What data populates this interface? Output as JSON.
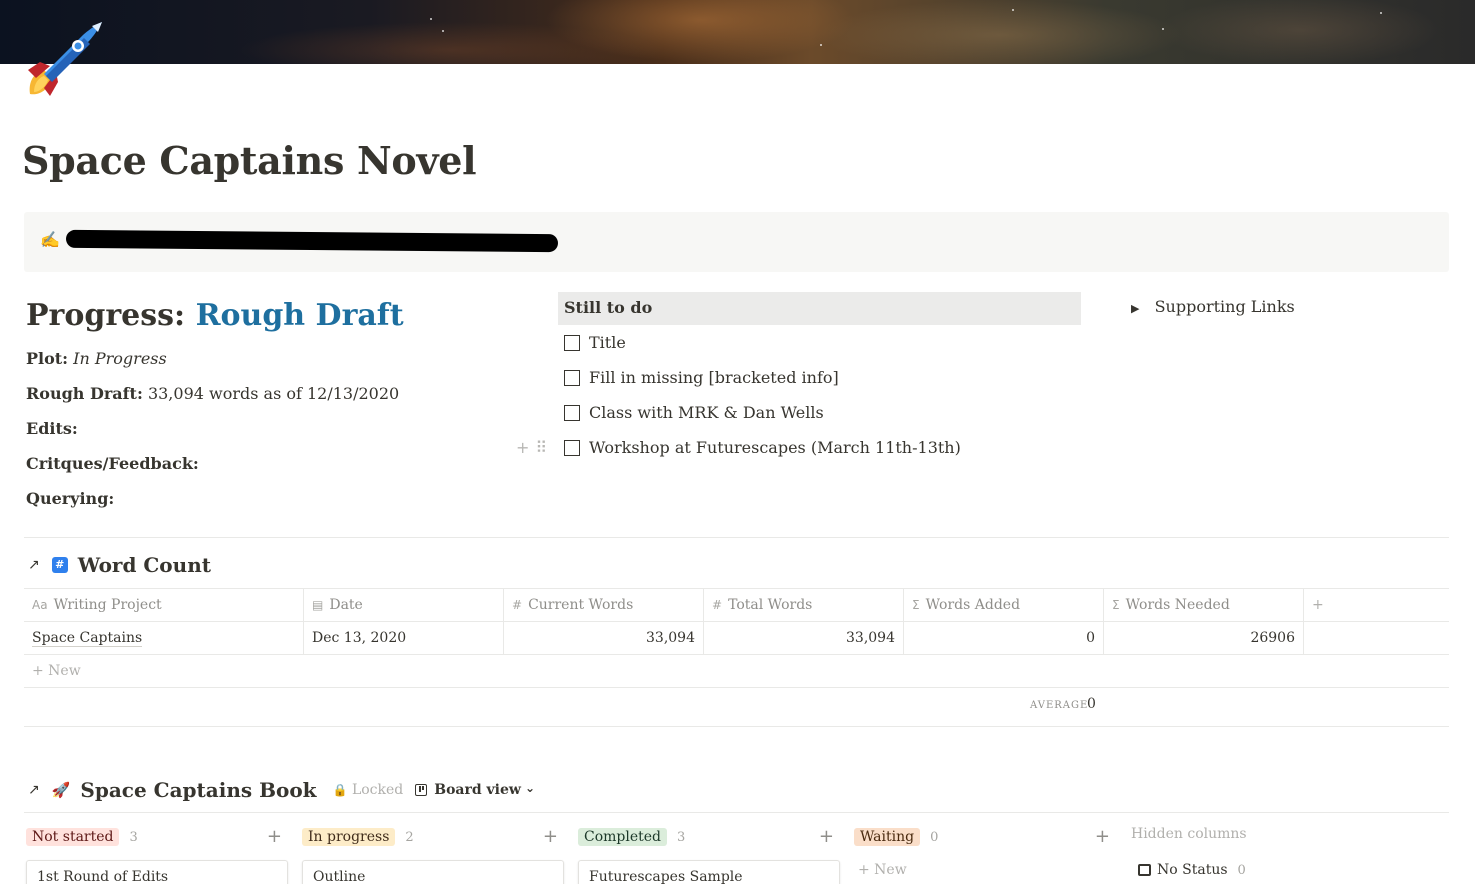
{
  "page": {
    "title": "Space Captains Novel",
    "icon": "rocket-icon"
  },
  "callout": {
    "icon": "writing-hand-icon",
    "text_redacted": true
  },
  "progress": {
    "label": "Progress:",
    "stage": "Rough Draft",
    "accent_color": "#1e6f9f",
    "fields": [
      {
        "label": "Plot:",
        "value": "In Progress",
        "italic": true
      },
      {
        "label": "Rough Draft:",
        "value": "33,094 words as of 12/13/2020"
      },
      {
        "label": "Edits:",
        "value": ""
      },
      {
        "label": "Critques/Feedback:",
        "value": ""
      },
      {
        "label": "Querying:",
        "value": ""
      }
    ]
  },
  "todo": {
    "header": "Still to do",
    "items": [
      {
        "label": "Title",
        "checked": false
      },
      {
        "label": "Fill in missing [bracketed info]",
        "checked": false
      },
      {
        "label": "Class with MRK & Dan Wells",
        "checked": false
      },
      {
        "label": "Workshop at Futurescapes (March 11th-13th)",
        "checked": false
      }
    ],
    "handle_plus": "+",
    "handle_dots": "⠿"
  },
  "supporting_links": {
    "label": "Supporting Links",
    "arrow": "▶"
  },
  "word_count": {
    "arrow": "↗",
    "icon_glyph": "#",
    "title": "Word Count",
    "columns": [
      {
        "icon": "Aa",
        "label": "Writing Project"
      },
      {
        "icon": "▤",
        "label": "Date"
      },
      {
        "icon": "#",
        "label": "Current Words"
      },
      {
        "icon": "#",
        "label": "Total Words"
      },
      {
        "icon": "Σ",
        "label": "Words Added"
      },
      {
        "icon": "Σ",
        "label": "Words Needed"
      }
    ],
    "add_column": "+",
    "rows": [
      {
        "project": "Space Captains",
        "date": "Dec 13, 2020",
        "current": "33,094",
        "total": "33,094",
        "added": "0",
        "needed": "26906"
      }
    ],
    "new_label": "+ New",
    "calc_label": "AVERAGE",
    "calc_value": "0"
  },
  "book": {
    "arrow": "↗",
    "icon_glyph": "🚀",
    "title": "Space Captains Book",
    "locked_label": "Locked",
    "view_label": "Board view",
    "view_chevron": "⌄",
    "columns": [
      {
        "label": "Not started",
        "count": "3",
        "bg": "#ffe2dd",
        "card": "1st Round of Edits"
      },
      {
        "label": "In progress",
        "count": "2",
        "bg": "#fdecc8",
        "card": "Outline"
      },
      {
        "label": "Completed",
        "count": "3",
        "bg": "#dbeddb",
        "card": "Futurescapes Sample"
      },
      {
        "label": "Waiting",
        "count": "0",
        "bg": "#fadec9",
        "card": ""
      }
    ],
    "plus": "+",
    "new_label": "+ New",
    "hidden_columns_label": "Hidden columns",
    "no_status_label": "No Status",
    "no_status_count": "0"
  }
}
